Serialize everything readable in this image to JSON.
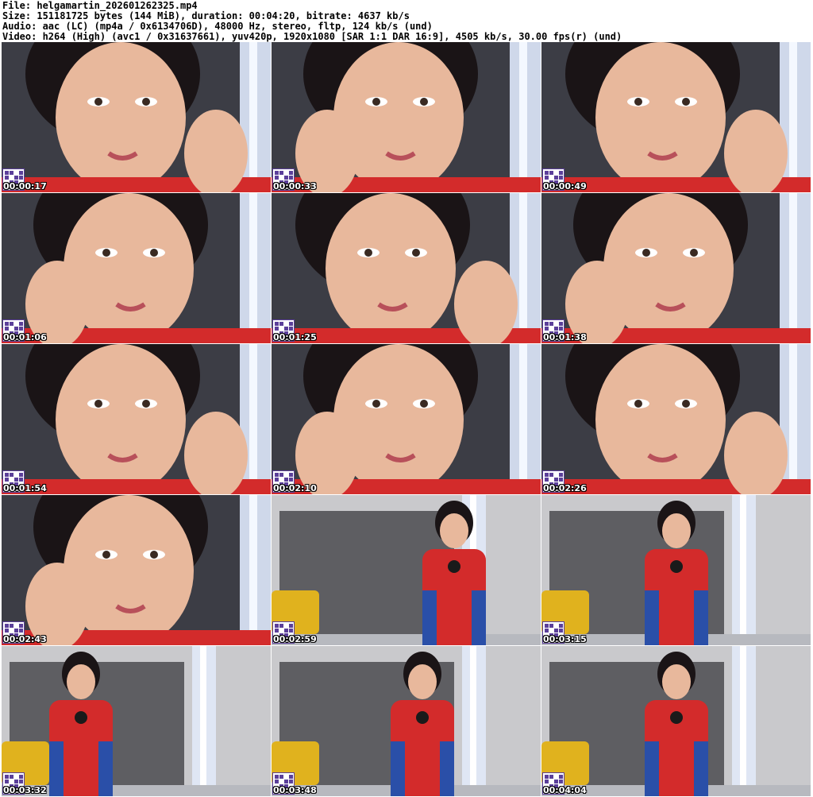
{
  "header": {
    "lines": [
      "File: helgamartin_202601262325.mp4",
      "Size: 151181725 bytes (144 MiB), duration: 00:04:20, bitrate: 4637 kb/s",
      "Audio: aac (LC) (mp4a / 0x6134706D), 48000 Hz, stereo, fltp, 124 kb/s (und)",
      "Video: h264 (High) (avc1 / 0x31637661), yuv420p, 1920x1080 [SAR 1:1 DAR 16:9], 4505 kb/s, 30.00 fps(r) (und)"
    ]
  },
  "thumbnails": [
    {
      "timestamp": "00:00:17",
      "scene": "closeup"
    },
    {
      "timestamp": "00:00:33",
      "scene": "closeup"
    },
    {
      "timestamp": "00:00:49",
      "scene": "closeup"
    },
    {
      "timestamp": "00:01:06",
      "scene": "closeup"
    },
    {
      "timestamp": "00:01:25",
      "scene": "closeup"
    },
    {
      "timestamp": "00:01:38",
      "scene": "closeup"
    },
    {
      "timestamp": "00:01:54",
      "scene": "closeup"
    },
    {
      "timestamp": "00:02:10",
      "scene": "closeup"
    },
    {
      "timestamp": "00:02:26",
      "scene": "closeup"
    },
    {
      "timestamp": "00:02:43",
      "scene": "closeup"
    },
    {
      "timestamp": "00:02:59",
      "scene": "room"
    },
    {
      "timestamp": "00:03:15",
      "scene": "room"
    },
    {
      "timestamp": "00:03:32",
      "scene": "room"
    },
    {
      "timestamp": "00:03:48",
      "scene": "room"
    },
    {
      "timestamp": "00:04:04",
      "scene": "room"
    }
  ],
  "colors": {
    "background": "#ffffff",
    "text": "#000000",
    "timestamp_text": "#ffffff",
    "qr_badge": "#5b3f9a",
    "suit_red": "#d32b2b",
    "suit_blue": "#2a4fa8",
    "curtain": "#5e5e62",
    "wall": "#c9c9cc",
    "chair": "#e0b21e",
    "skin": "#e8b89c",
    "hair": "#1a1416"
  }
}
